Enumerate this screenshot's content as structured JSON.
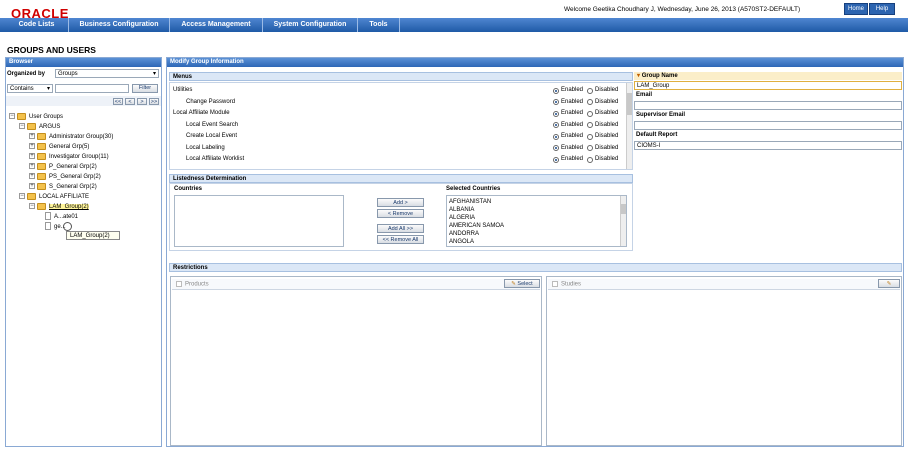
{
  "header": {
    "logo": "ORACLE",
    "welcome": "Welcome Geetika Choudhary J, Wednesday, June 26, 2013 (A570ST2-DEFAULT)",
    "home_label": "Home",
    "help_label": "Help"
  },
  "nav": [
    "Code Lists",
    "Business Configuration",
    "Access Management",
    "System Configuration",
    "Tools"
  ],
  "page_title": "GROUPS AND USERS",
  "browser": {
    "title": "Browser",
    "organized_by_label": "Organized by",
    "organized_by_value": "Groups",
    "filter_mode": "Contains",
    "filter_value": "",
    "filter_button": "Filter",
    "pager": [
      "<<",
      "<",
      ">",
      ">>"
    ],
    "tree": {
      "root": "User Groups",
      "argus": "ARGUS",
      "argus_children": [
        "Administrator Group(30)",
        "General Grp(5)",
        "Investigator Group(11)",
        "P_General Grp(2)",
        "PS_General Grp(2)",
        "S_General Grp(2)"
      ],
      "local_affiliate": "LOCAL AFFILIATE",
      "lam_group": "LAM_Group(2)",
      "lam_children": [
        "A...ate01",
        "ge..."
      ],
      "tooltip": "LAM_Group(2)"
    }
  },
  "modify": {
    "title": "Modify Group Information",
    "menus_title": "Menus",
    "enabled_label": "Enabled",
    "disabled_label": "Disabled",
    "menus": [
      {
        "label": "Utilities",
        "indent": false
      },
      {
        "label": "Change Password",
        "indent": true
      },
      {
        "label": "Local Affiliate Module",
        "indent": false
      },
      {
        "label": "Local Event Search",
        "indent": true
      },
      {
        "label": "Create Local Event",
        "indent": true
      },
      {
        "label": "Local Labeling",
        "indent": true
      },
      {
        "label": "Local Affiliate Worklist",
        "indent": true
      }
    ],
    "listedness_title": "Listedness Determination",
    "countries_label": "Countries",
    "selected_countries_label": "Selected Countries",
    "add_button": "Add >",
    "remove_button": "< Remove",
    "add_all_button": "Add All >>",
    "remove_all_button": "<< Remove All",
    "selected_countries": [
      "AFGHANISTAN",
      "ALBANIA",
      "ALGERIA",
      "AMERICAN SAMOA",
      "ANDORRA",
      "ANGOLA"
    ],
    "restrictions_title": "Restrictions",
    "products_label": "Products",
    "studies_label": "Studies",
    "select_button": "Select"
  },
  "group": {
    "name_label": "Group Name",
    "name_value": "LAM_Group",
    "email_label": "Email",
    "email_value": "",
    "supervisor_email_label": "Supervisor Email",
    "supervisor_email_value": "",
    "default_report_label": "Default Report",
    "default_report_value": "CIOMS-I"
  },
  "colors": {
    "nav_blue": "#2e67b6",
    "brand_red": "#d00000",
    "folder_yellow": "#f3c14b"
  }
}
